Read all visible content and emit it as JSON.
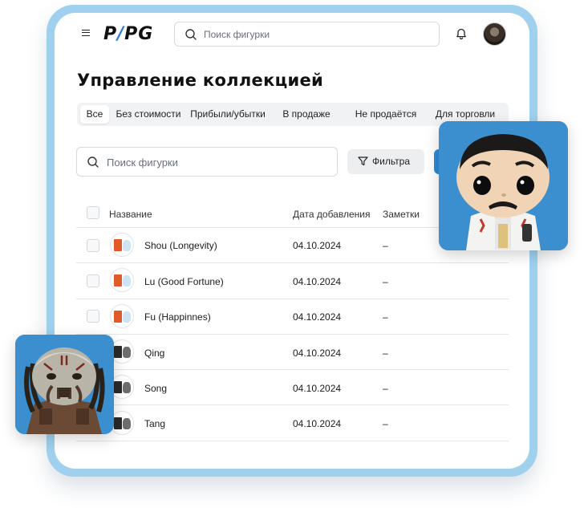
{
  "header": {
    "logo": {
      "left": "P",
      "slash": "/",
      "right": "PG"
    },
    "search_placeholder": "Поиск фигурки",
    "icons": [
      "menu-icon",
      "search-icon",
      "bell-icon",
      "avatar"
    ]
  },
  "page_title": "Управление коллекцией",
  "tabs": [
    {
      "label": "Все",
      "active": true
    },
    {
      "label": "Без стоимости"
    },
    {
      "label": "Прибыли/убытки"
    },
    {
      "label": "В продаже"
    },
    {
      "label": "Не продаётся"
    },
    {
      "label": "Для торговли"
    }
  ],
  "filter": {
    "search_placeholder": "Поиск фигурки",
    "filter_label": "Фильтра"
  },
  "table": {
    "columns": {
      "name": "Название",
      "date": "Дата добавления",
      "notes": "Заметки"
    },
    "rows": [
      {
        "name": "Shou (Longevity)",
        "date": "04.10.2024",
        "notes": "–"
      },
      {
        "name": "Lu (Good Fortune)",
        "date": "04.10.2024",
        "notes": "–"
      },
      {
        "name": "Fu (Happinnes)",
        "date": "04.10.2024",
        "notes": "–"
      },
      {
        "name": "Qing",
        "date": "04.10.2024",
        "notes": "–"
      },
      {
        "name": "Song",
        "date": "04.10.2024",
        "notes": "–"
      },
      {
        "name": "Tang",
        "date": "04.10.2024",
        "notes": "–"
      }
    ]
  },
  "colors": {
    "frame": "#9fd0ee",
    "accent": "#2d8ad6",
    "card_bg": "#3b8fcf"
  }
}
